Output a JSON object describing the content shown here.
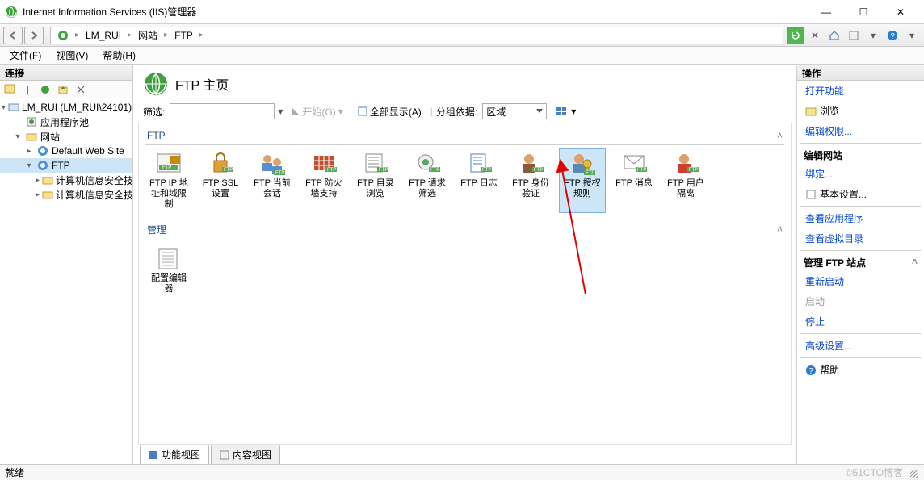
{
  "window": {
    "title": "Internet Information Services (IIS)管理器",
    "minimize": "—",
    "maximize": "☐",
    "close": "✕"
  },
  "breadcrumb": {
    "segs": [
      "LM_RUI",
      "网站",
      "FTP"
    ]
  },
  "menubar": {
    "file": "文件(F)",
    "view": "视图(V)",
    "help": "帮助(H)"
  },
  "tree": {
    "header": "连接",
    "root": "LM_RUI (LM_RUI\\24101)",
    "app_pools": "应用程序池",
    "sites": "网站",
    "default_site": "Default Web Site",
    "ftp": "FTP",
    "sub1": "计算机信息安全技",
    "sub2": "计算机信息安全技"
  },
  "page": {
    "title": "FTP 主页",
    "filter_label": "筛选:",
    "go_label": "开始(G)",
    "show_all": "全部显示(A)",
    "group_by_label": "分组依据:",
    "group_by_value": "区域",
    "group_ftp": "FTP",
    "group_mgmt": "管理",
    "features": {
      "ip": "FTP IP 地址和域限制",
      "ssl": "FTP SSL 设置",
      "session": "FTP 当前会话",
      "firewall": "FTP 防火墙支持",
      "browse": "FTP 目录浏览",
      "filter": "FTP 请求筛选",
      "log": "FTP 日志",
      "auth": "FTP 身份验证",
      "authz": "FTP 授权规则",
      "msg": "FTP 消息",
      "isolation": "FTP 用户隔离",
      "config": "配置编辑器"
    },
    "tabs": {
      "features_view": "功能视图",
      "content_view": "内容视图"
    }
  },
  "actions": {
    "header": "操作",
    "open_feature": "打开功能",
    "explore": "浏览",
    "edit_perm": "编辑权限...",
    "group_site": "编辑网站",
    "bindings": "绑定...",
    "basic": "基本设置...",
    "view_apps": "查看应用程序",
    "view_vdirs": "查看虚拟目录",
    "group_ftp": "管理 FTP 站点",
    "restart": "重新启动",
    "start": "启动",
    "stop": "停止",
    "advanced": "高级设置...",
    "help": "帮助"
  },
  "status": {
    "text": "就绪",
    "watermark": "©51CTO博客"
  }
}
